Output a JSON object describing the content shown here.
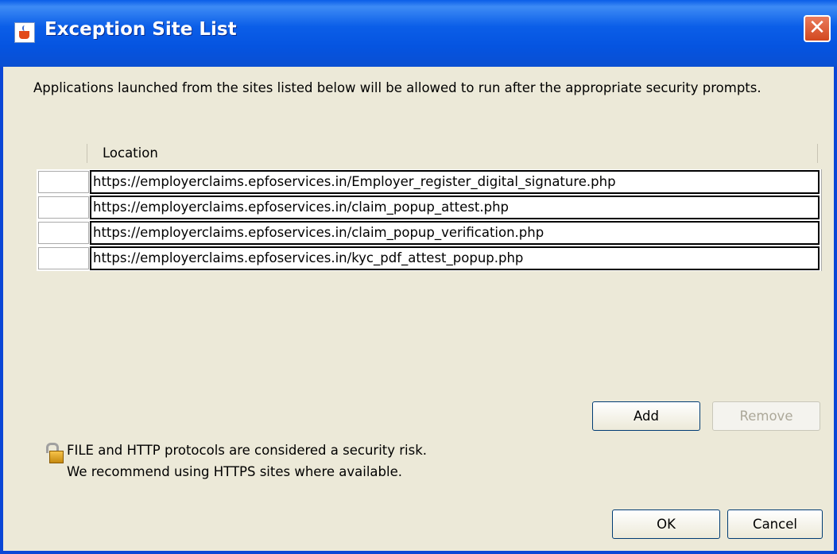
{
  "window": {
    "title": "Exception Site List",
    "close_glyph": "✕"
  },
  "description": "Applications launched from the sites listed below will be allowed to run after the appropriate security prompts.",
  "table": {
    "column_header": "Location",
    "rows": [
      "https://employerclaims.epfoservices.in/Employer_register_digital_signature.php",
      "https://employerclaims.epfoservices.in/claim_popup_attest.php",
      "https://employerclaims.epfoservices.in/claim_popup_verification.php",
      "https://employerclaims.epfoservices.in/kyc_pdf_attest_popup.php"
    ]
  },
  "buttons": {
    "add": "Add",
    "remove": "Remove",
    "ok": "OK",
    "cancel": "Cancel"
  },
  "warning": {
    "line1": "FILE and HTTP protocols are considered a security risk.",
    "line2": "We recommend using HTTPS sites where available."
  },
  "icons": {
    "app": "java-icon",
    "warning": "lock-icon"
  },
  "colors": {
    "titlebar": "#0a5de8",
    "dialog_bg": "#ece9d8",
    "close": "#d2481f"
  }
}
